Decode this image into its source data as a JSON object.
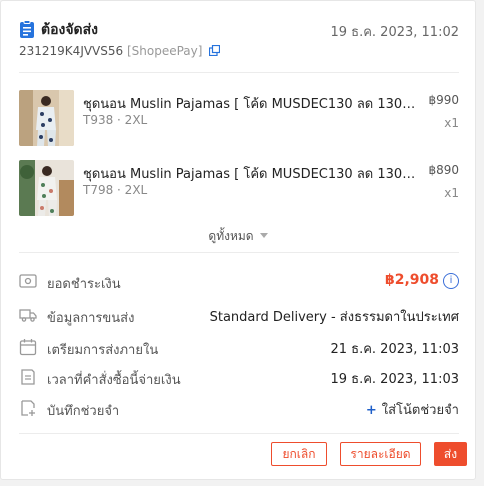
{
  "header": {
    "status": "ต้องจัดส่ง",
    "date": "19 ธ.ค. 2023, 11:02",
    "order_id": "231219K4JVVS56",
    "payment_method": "[ShopeePay]"
  },
  "items": [
    {
      "name": "ชุดนอน Muslin Pajamas [ โค้ด MUSDEC130 ลด 130 ...",
      "variant": "T938 · 2XL",
      "price": "฿990",
      "qty": "x1"
    },
    {
      "name": "ชุดนอน Muslin Pajamas [ โค้ด MUSDEC130 ลด 130 ...",
      "variant": "T798 · 2XL",
      "price": "฿890",
      "qty": "x1"
    }
  ],
  "view_all": "ดูทั้งหมด",
  "details": {
    "total_label": "ยอดชำระเงิน",
    "total_value": "฿2,908",
    "shipping_label": "ข้อมูลการขนส่ง",
    "shipping_value": "Standard Delivery - ส่งธรรมดาในประเทศ",
    "prepare_label": "เตรียมการส่งภายใน",
    "prepare_value": "21 ธ.ค. 2023, 11:03",
    "paid_label": "เวลาที่คำสั่งซื้อนี้จ่ายเงิน",
    "paid_value": "19 ธ.ค. 2023, 11:03",
    "note_label": "บันทึกช่วยจำ",
    "note_action": "ใส่โน้ตช่วยจำ",
    "info_glyph": "i"
  },
  "actions": {
    "cancel": "ยกเลิก",
    "details": "รายละเอียด",
    "ship": "ส่ง"
  },
  "colors": {
    "accent": "#ee4d2d",
    "link": "#1f5fc9",
    "status_icon": "#2673dd"
  }
}
